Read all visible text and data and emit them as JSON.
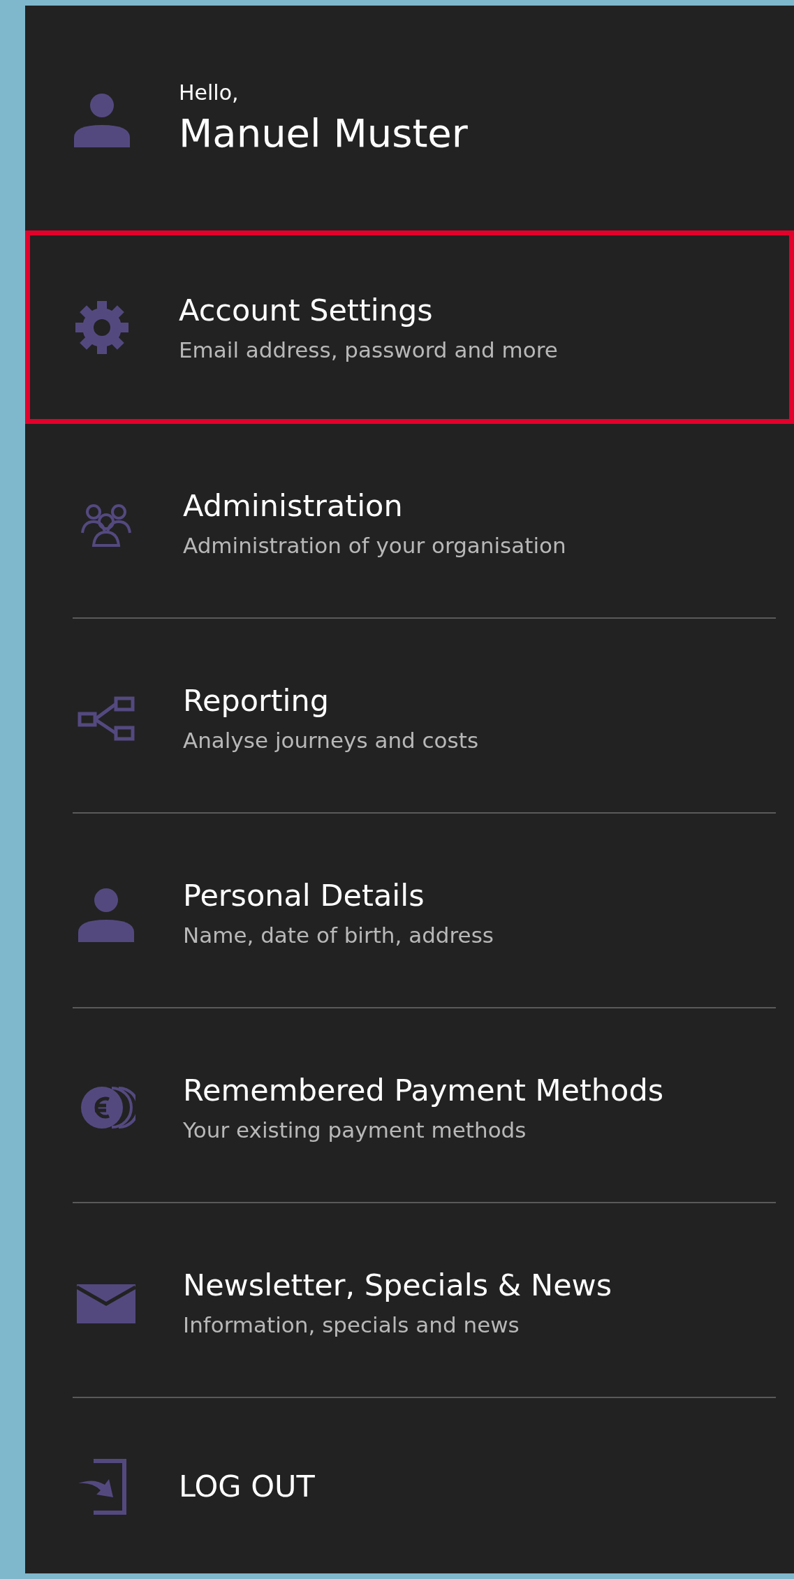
{
  "header": {
    "greeting": "Hello,",
    "name": "Manuel Muster"
  },
  "menu": [
    {
      "kind": "gear",
      "title": "Account Settings",
      "subtitle": "Email address, password and more",
      "selected": true
    },
    {
      "kind": "group",
      "title": "Administration",
      "subtitle": "Administration of your organisation",
      "selected": false
    },
    {
      "kind": "hierarchy",
      "title": "Reporting",
      "subtitle": "Analyse journeys and costs",
      "selected": false
    },
    {
      "kind": "person",
      "title": "Personal Details",
      "subtitle": "Name, date of birth, address",
      "selected": false
    },
    {
      "kind": "coins",
      "title": "Remembered Payment Methods",
      "subtitle": "Your existing payment methods",
      "selected": false
    },
    {
      "kind": "envelope",
      "title": "Newsletter, Specials & News",
      "subtitle": "Information, specials and news",
      "selected": false
    }
  ],
  "logout": {
    "label": "LOG OUT"
  }
}
